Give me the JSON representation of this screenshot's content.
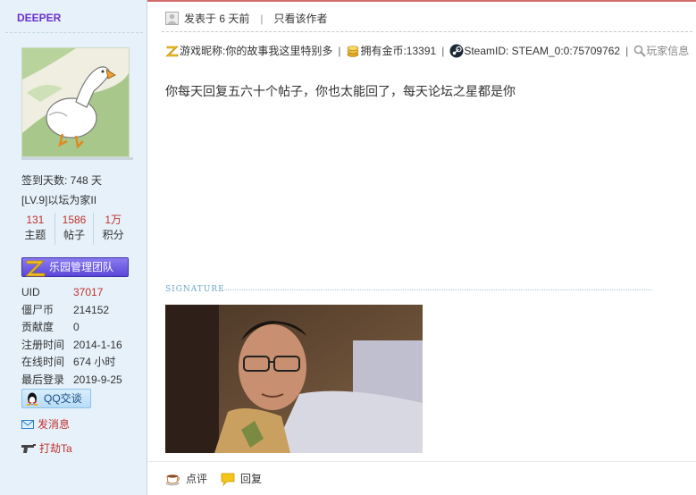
{
  "user": {
    "name": "DEEPER",
    "checkin": "签到天数: 748 天",
    "level": "[LV.9]以坛为家II",
    "counts": [
      {
        "value": "131",
        "label": "主题"
      },
      {
        "value": "1586",
        "label": "帖子"
      },
      {
        "value": "1万",
        "label": "积分"
      }
    ],
    "team_badge": "乐园管理团队",
    "info": [
      {
        "key": "UID",
        "value": "37017"
      },
      {
        "key": "僵尸币",
        "value": "214152"
      },
      {
        "key": "贡献度",
        "value": "0"
      },
      {
        "key": "注册时间",
        "value": "2014-1-16"
      },
      {
        "key": "在线时间",
        "value": "674 小时"
      },
      {
        "key": "最后登录",
        "value": "2019-9-25"
      }
    ],
    "qq_label": "QQ交谈",
    "message_label": "发消息",
    "rob_label": "打劫Ta"
  },
  "post": {
    "posted": "发表于 6 天前",
    "only_author": "只看该作者",
    "game_nick": "游戏昵称:你的故事我这里特别多",
    "gold": "拥有金币:13391",
    "steam": "SteamID: STEAM_0:0:75709762",
    "player_info": "玩家信息",
    "text": "你每天回复五六十个帖子，你也太能回了，每天论坛之星都是你",
    "signature_label": "SIGNATURE",
    "rate_label": "点评",
    "reply_label": "回复"
  },
  "colors": {
    "username": "#6a2fd0",
    "accent_red": "#c2322c",
    "sidebar_bg": "#e6f1fa",
    "team_badge": "#5b47d8"
  }
}
